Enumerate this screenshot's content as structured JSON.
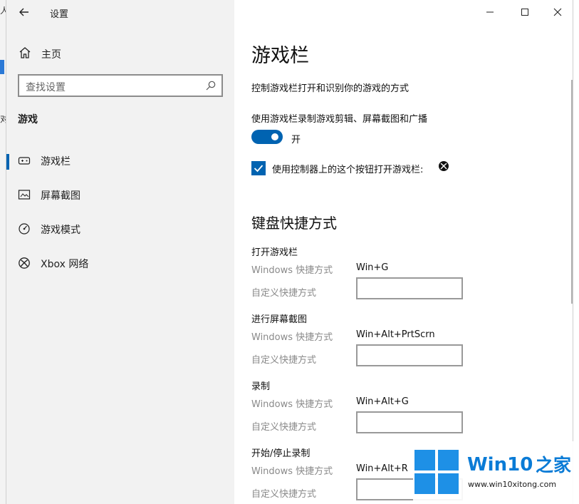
{
  "background_fragments": [
    "人",
    "对"
  ],
  "window": {
    "title": "设置"
  },
  "sidebar": {
    "home_label": "主页",
    "search_placeholder": "查找设置",
    "category": "游戏",
    "items": [
      {
        "label": "游戏栏",
        "icon": "gamebar-icon",
        "selected": true
      },
      {
        "label": "屏幕截图",
        "icon": "screenshot-icon",
        "selected": false
      },
      {
        "label": "游戏模式",
        "icon": "gamemode-icon",
        "selected": false
      },
      {
        "label": "Xbox 网络",
        "icon": "xbox-icon",
        "selected": false
      }
    ]
  },
  "main": {
    "heading": "游戏栏",
    "description": "控制游戏栏打开和识别你的游戏的方式",
    "toggle_label": "使用游戏栏录制游戏剪辑、屏幕截图和广播",
    "toggle_state": "开",
    "checkbox_label": "使用控制器上的这个按钮打开游戏栏:",
    "checkbox_checked": true,
    "shortcuts_heading": "键盘快捷方式",
    "shortcut_groups": [
      {
        "title": "打开游戏栏",
        "windows_label": "Windows 快捷方式",
        "windows_value": "Win+G",
        "custom_label": "自定义快捷方式"
      },
      {
        "title": "进行屏幕截图",
        "windows_label": "Windows 快捷方式",
        "windows_value": "Win+Alt+PrtScrn",
        "custom_label": "自定义快捷方式"
      },
      {
        "title": "录制",
        "windows_label": "Windows 快捷方式",
        "windows_value": "Win+Alt+G",
        "custom_label": "自定义快捷方式"
      },
      {
        "title": "开始/停止录制",
        "windows_label": "Windows 快捷方式",
        "windows_value": "Win+Alt+R",
        "custom_label": "自定义快捷方式"
      }
    ]
  },
  "watermark": {
    "brand": "Win10",
    "brand_suffix": "之家",
    "url": "www.win10xitong.com"
  },
  "colors": {
    "accent": "#0063b1",
    "sidebar_bg": "#f2f2f2",
    "watermark_blue": "#0a7bd6"
  }
}
